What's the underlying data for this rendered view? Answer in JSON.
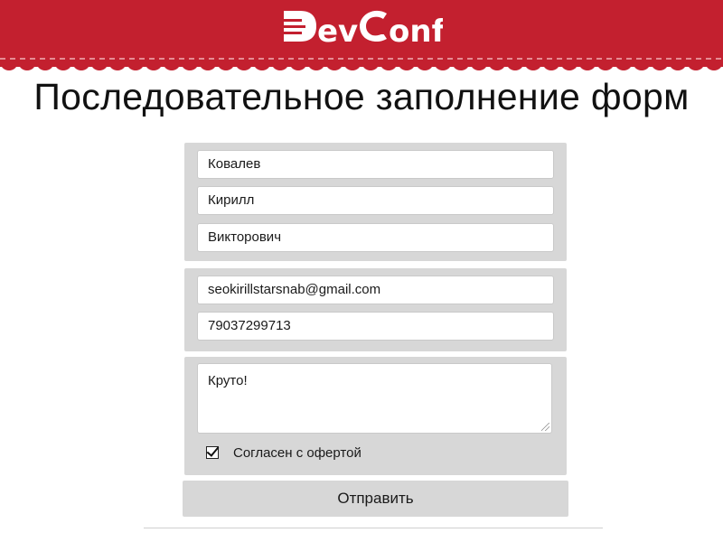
{
  "header": {
    "logo_text": "DevConf",
    "color": "#c3202f"
  },
  "title": "Последовательное заполнение форм",
  "form": {
    "name_group": {
      "last_name": "Ковалев",
      "first_name": "Кирилл",
      "patronymic": "Викторович"
    },
    "contact_group": {
      "email": "seokirillstarsnab@gmail.com",
      "phone": "79037299713"
    },
    "comment_group": {
      "comment": "Круто!",
      "agree_checked": true,
      "agree_label": "Согласен с офертой"
    },
    "submit_label": "Отправить"
  }
}
